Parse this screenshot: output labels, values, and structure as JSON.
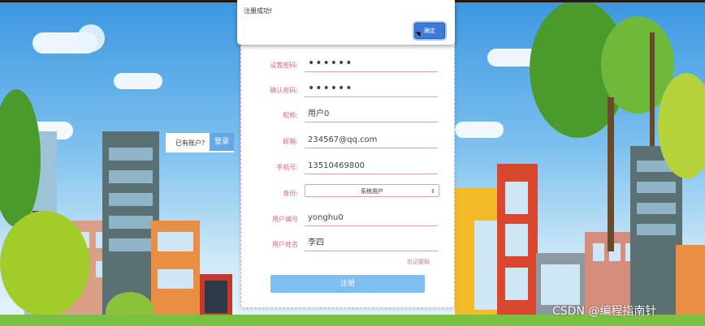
{
  "dialog": {
    "message": "注册成功!",
    "ok_label": "确定"
  },
  "login_prompt": {
    "text": "已有账户?",
    "button_label": "登录"
  },
  "form": {
    "fields": [
      {
        "label": "设置密码:",
        "value": "••••••"
      },
      {
        "label": "确认密码:",
        "value": "••••••"
      },
      {
        "label": "昵称:",
        "value": "用户0"
      },
      {
        "label": "邮箱:",
        "value": "234567@qq.com"
      },
      {
        "label": "手机号:",
        "value": "13510469800"
      },
      {
        "label": "身份:",
        "value": "系统用户"
      },
      {
        "label": "用户编号",
        "value": "yonghu0"
      },
      {
        "label": "用户姓名",
        "value": "李四"
      }
    ],
    "forgot_label": "忘记密码",
    "register_label": "注册"
  },
  "watermark": "CSDN @编程指南针",
  "colors": {
    "accent": "#7fbef0",
    "label": "#d06a8a",
    "ok_button": "#3e7bd8"
  }
}
